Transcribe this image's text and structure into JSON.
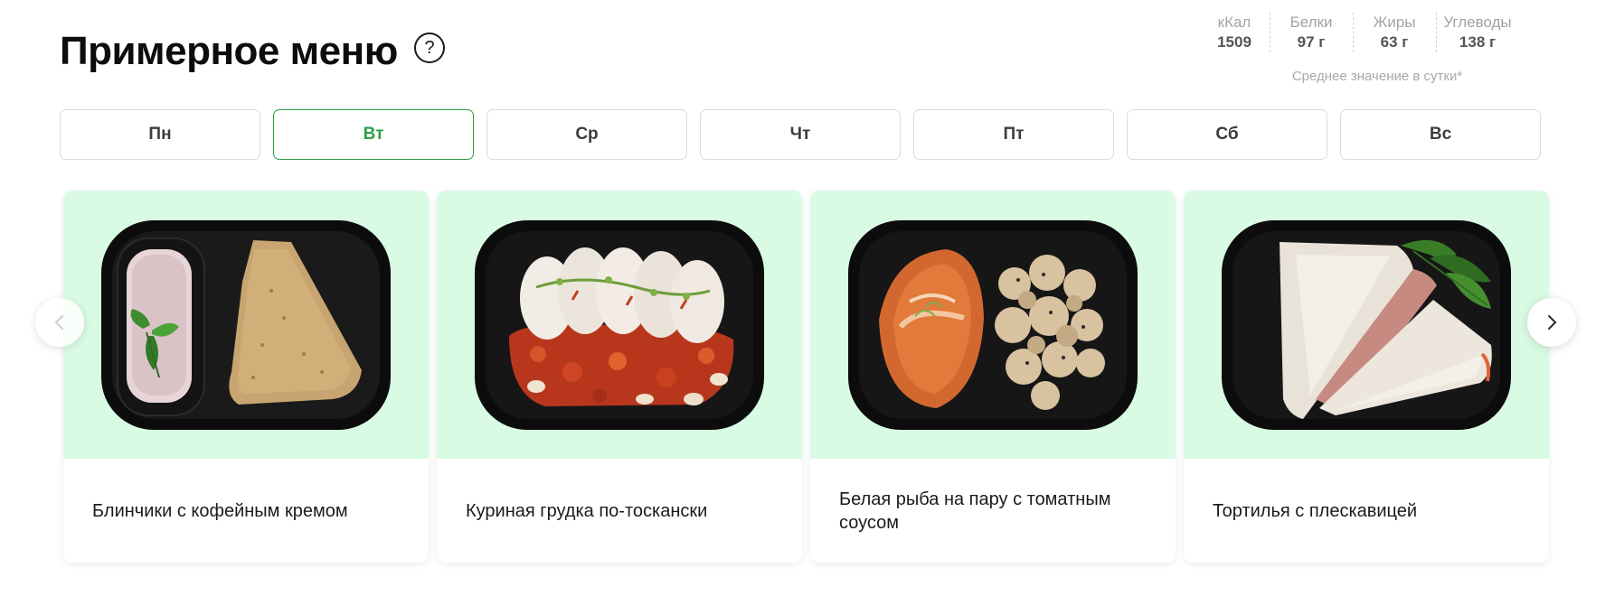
{
  "header": {
    "title": "Примерное меню",
    "help_symbol": "?"
  },
  "nutrition": {
    "items": [
      {
        "label": "кКал",
        "value": "1509"
      },
      {
        "label": "Белки",
        "value": "97 г"
      },
      {
        "label": "Жиры",
        "value": "63 г"
      },
      {
        "label": "Углеводы",
        "value": "138 г"
      }
    ],
    "note": "Среднее значение в сутки*"
  },
  "days": {
    "active": "Вт",
    "items": [
      "Пн",
      "Вт",
      "Ср",
      "Чт",
      "Пт",
      "Сб",
      "Вс"
    ]
  },
  "cards": [
    {
      "title": "Блинчики с кофейным кремом",
      "image_icon": "pancakes-with-cream-dish"
    },
    {
      "title": "Куриная грудка по-тоскански",
      "image_icon": "sliced-chicken-breast-dish"
    },
    {
      "title": "Белая рыба на пару с томатным соусом",
      "image_icon": "steamed-fish-with-cauliflower-dish"
    },
    {
      "title": "Тортилья с плескавицей",
      "image_icon": "tortilla-wrap-dish"
    }
  ],
  "carousel": {
    "prev_icon": "chevron-left-icon",
    "next_icon": "chevron-right-icon"
  },
  "colors": {
    "accent": "#26a046",
    "card_background": "#d9fbe3",
    "tray": "#0c0c0c"
  }
}
